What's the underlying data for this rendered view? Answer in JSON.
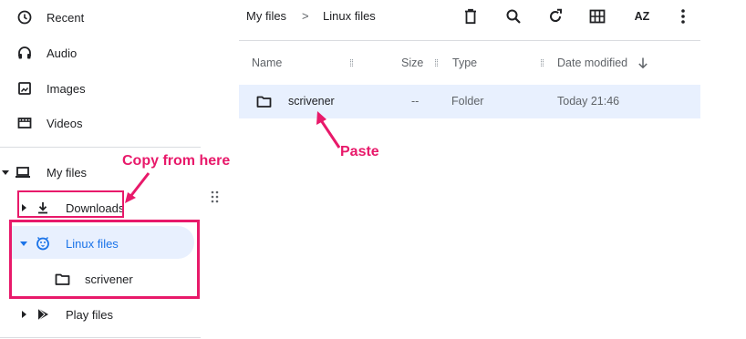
{
  "sidebar": {
    "items": [
      {
        "label": "Recent",
        "icon": "clock-icon"
      },
      {
        "label": "Audio",
        "icon": "headphones-icon"
      },
      {
        "label": "Images",
        "icon": "image-icon"
      },
      {
        "label": "Videos",
        "icon": "video-icon"
      }
    ],
    "my_files": {
      "label": "My files",
      "icon": "laptop-icon"
    },
    "downloads": {
      "label": "Downloads",
      "icon": "download-icon"
    },
    "linux_files": {
      "label": "Linux files",
      "icon": "penguin-icon"
    },
    "scrivener": {
      "label": "scrivener",
      "icon": "folder-icon"
    },
    "play_files": {
      "label": "Play files",
      "icon": "play-store-icon"
    }
  },
  "breadcrumb": {
    "root": "My files",
    "separator": ">",
    "current": "Linux files"
  },
  "toolbar": {
    "sort_label": "AZ"
  },
  "table": {
    "columns": {
      "name": "Name",
      "size": "Size",
      "type": "Type",
      "date": "Date modified"
    },
    "rows": [
      {
        "name": "scrivener",
        "size": "--",
        "type": "Folder",
        "date": "Today 21:46",
        "icon": "folder-icon"
      }
    ]
  },
  "annotations": {
    "copy_from": "Copy from here",
    "paste": "Paste"
  },
  "colors": {
    "accent": "#1a73e8",
    "selection": "#e8f0fe",
    "annotation": "#e8196a"
  }
}
